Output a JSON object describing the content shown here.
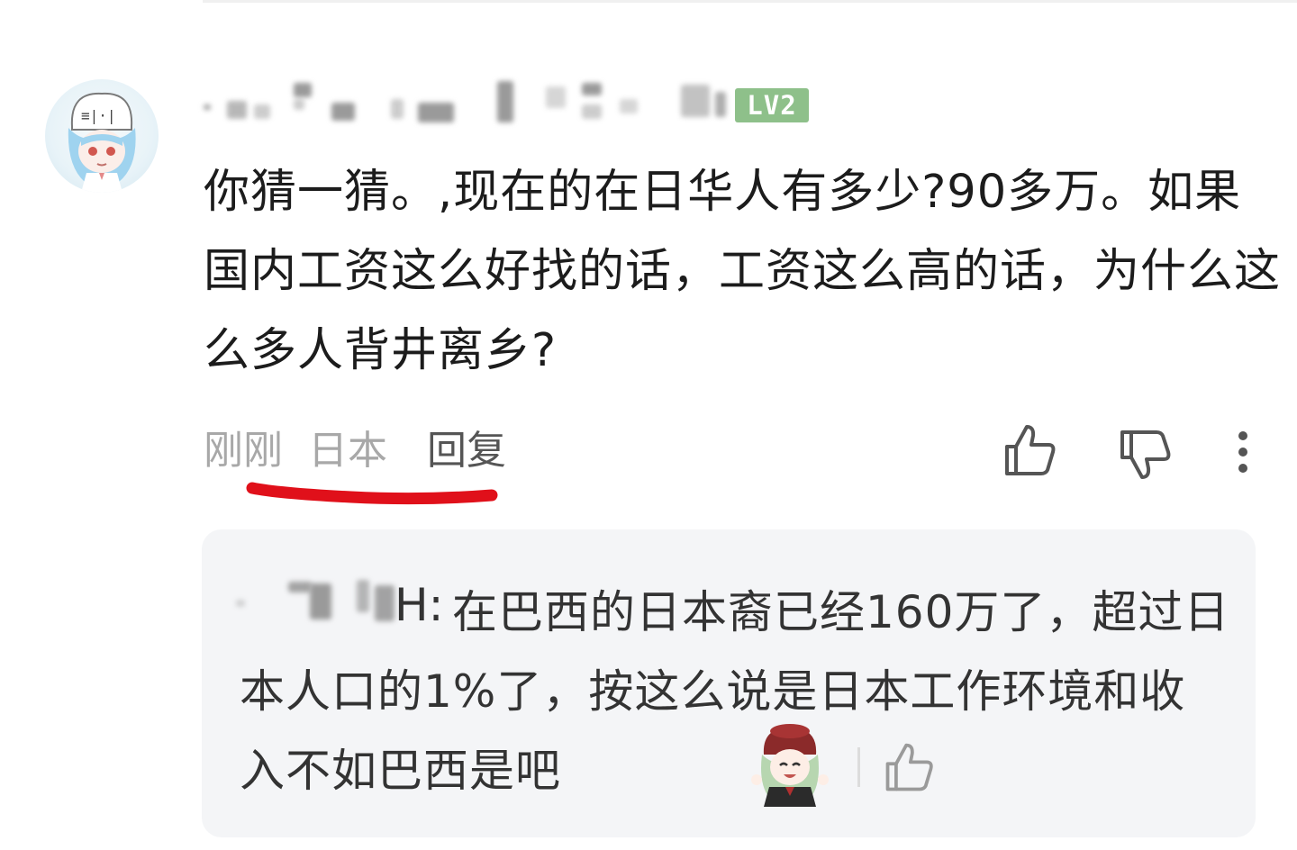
{
  "comment": {
    "level_badge": "LV2",
    "text": "你猜一猜。,现在的在日华人有多少?90多万。如果国内工资这么好找的话，工资这么高的话，为什么这么多人背井离乡?",
    "time": "刚刚",
    "location": "日本",
    "reply_label": "回复",
    "icons": {
      "like": "thumbs-up-icon",
      "dislike": "thumbs-down-icon",
      "more": "more-vertical-icon"
    }
  },
  "annotation": {
    "underline_color": "#e0101a"
  },
  "reply": {
    "username_suffix": "H:",
    "text": "在巴西的日本裔已经160万了，超过日本人口的1%了，按这么说是日本工作环境和收入不如巴西是吧",
    "icons": {
      "sticker": "anime-girl-sticker",
      "like": "thumbs-up-icon"
    }
  },
  "colors": {
    "level_badge": "#8ec08a",
    "reply_background": "#f4f5f7",
    "meta_text": "#a8a8a8"
  }
}
